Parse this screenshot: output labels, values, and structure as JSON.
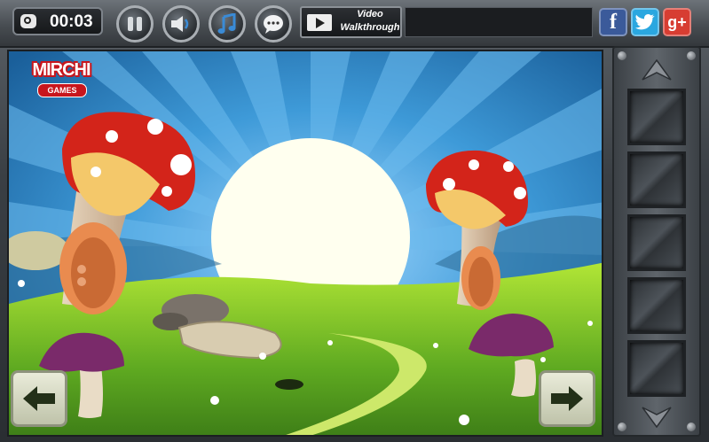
{
  "hud": {
    "timer": "00:03",
    "video_line1": "Video",
    "video_line2": "Walkthrough"
  },
  "logo": {
    "brand": "MIRCHI",
    "sub": "GAMES"
  },
  "social": {
    "facebook": "f",
    "twitter": "t",
    "google": "g+"
  },
  "inventory": {
    "slots": [
      "",
      "",
      "",
      "",
      ""
    ]
  },
  "colors": {
    "sky": "#2f86c9",
    "grass": "#7bc12b",
    "mushroom_red": "#d3241a",
    "mushroom_purple": "#7a2a6a",
    "facebook": "#3b5a9a",
    "twitter": "#2aa7e0",
    "google": "#d73d32"
  }
}
